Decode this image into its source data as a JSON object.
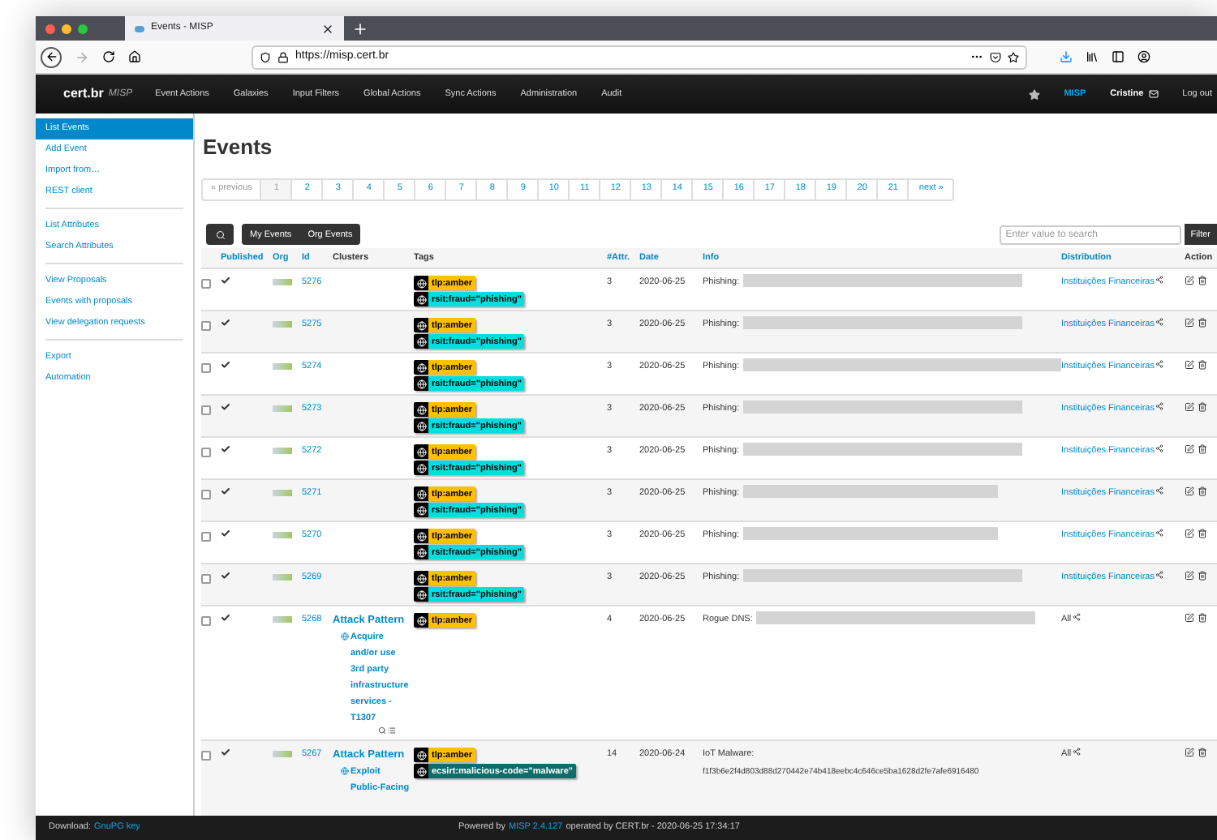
{
  "browser": {
    "tab_title": "Events - MISP",
    "url": "https://misp.cert.br"
  },
  "navbar": {
    "brand": "cert.br",
    "brand_sub": "MISP",
    "items": [
      "Event Actions",
      "Galaxies",
      "Input Filters",
      "Global Actions",
      "Sync Actions",
      "Administration",
      "Audit"
    ],
    "org": "MISP",
    "user": "Cristine",
    "logout": "Log out"
  },
  "sidebar": {
    "groups": [
      [
        {
          "label": "List Events",
          "selected": true
        },
        {
          "label": "Add Event",
          "selected": false
        },
        {
          "label": "Import from…",
          "selected": false
        },
        {
          "label": "REST client",
          "selected": false
        }
      ],
      [
        {
          "label": "List Attributes",
          "selected": false
        },
        {
          "label": "Search Attributes",
          "selected": false
        }
      ],
      [
        {
          "label": "View Proposals",
          "selected": false
        },
        {
          "label": "Events with proposals",
          "selected": false
        },
        {
          "label": "View delegation requests",
          "selected": false
        }
      ],
      [
        {
          "label": "Export",
          "selected": false
        },
        {
          "label": "Automation",
          "selected": false
        }
      ]
    ]
  },
  "page_title": "Events",
  "pagination": {
    "previous": "« previous",
    "next": "next »",
    "pages": [
      {
        "label": "1",
        "selected": true
      },
      {
        "label": "2",
        "selected": false
      },
      {
        "label": "3",
        "selected": false
      },
      {
        "label": "4",
        "selected": false
      },
      {
        "label": "5",
        "selected": false
      },
      {
        "label": "6",
        "selected": false
      },
      {
        "label": "7",
        "selected": false
      },
      {
        "label": "8",
        "selected": false
      },
      {
        "label": "9",
        "selected": false
      },
      {
        "label": "10",
        "selected": false
      },
      {
        "label": "11",
        "selected": false
      },
      {
        "label": "12",
        "selected": false
      },
      {
        "label": "13",
        "selected": false
      },
      {
        "label": "14",
        "selected": false
      },
      {
        "label": "15",
        "selected": false
      },
      {
        "label": "16",
        "selected": false
      },
      {
        "label": "17",
        "selected": false
      },
      {
        "label": "18",
        "selected": false
      },
      {
        "label": "19",
        "selected": false
      },
      {
        "label": "20",
        "selected": false
      },
      {
        "label": "21",
        "selected": false
      }
    ]
  },
  "toolbar": {
    "buttons": [
      "My Events",
      "Org Events"
    ],
    "search_placeholder": "Enter value to search",
    "filter": "Filter"
  },
  "table": {
    "columns": [
      {
        "label": "Published",
        "sortable": true
      },
      {
        "label": "Org",
        "sortable": true
      },
      {
        "label": "Id",
        "sortable": true
      },
      {
        "label": "Clusters",
        "sortable": false
      },
      {
        "label": "Tags",
        "sortable": false
      },
      {
        "label": "#Attr.",
        "sortable": true
      },
      {
        "label": "Date",
        "sortable": true
      },
      {
        "label": "Info",
        "sortable": true
      },
      {
        "label": "Distribution",
        "sortable": true
      },
      {
        "label": "Action",
        "sortable": false
      }
    ],
    "rows": [
      {
        "checked": false,
        "published": true,
        "id": "5276",
        "clusters": [],
        "tags": [
          {
            "label": "tlp:amber",
            "color": "#ffc000"
          },
          {
            "label": "rsit:fraud=\"phishing\"",
            "color": "#00dede"
          }
        ],
        "attributes": "3",
        "date": "2020-06-25",
        "info": "Phishing:",
        "redacted": true,
        "distribution": {
          "label": "Instituições Financeiras",
          "kind": "link"
        }
      },
      {
        "checked": false,
        "published": true,
        "id": "5275",
        "clusters": [],
        "tags": [
          {
            "label": "tlp:amber",
            "color": "#ffc000"
          },
          {
            "label": "rsit:fraud=\"phishing\"",
            "color": "#00dede"
          }
        ],
        "attributes": "3",
        "date": "2020-06-25",
        "info": "Phishing:",
        "redacted": true,
        "distribution": {
          "label": "Instituições Financeiras",
          "kind": "link"
        }
      },
      {
        "checked": false,
        "published": true,
        "id": "5274",
        "clusters": [],
        "tags": [
          {
            "label": "tlp:amber",
            "color": "#ffc000"
          },
          {
            "label": "rsit:fraud=\"phishing\"",
            "color": "#00dede"
          }
        ],
        "attributes": "3",
        "date": "2020-06-25",
        "info": "Phishing:",
        "redacted": true,
        "distribution": {
          "label": "Instituições Financeiras",
          "kind": "link"
        }
      },
      {
        "checked": false,
        "published": true,
        "id": "5273",
        "clusters": [],
        "tags": [
          {
            "label": "tlp:amber",
            "color": "#ffc000"
          },
          {
            "label": "rsit:fraud=\"phishing\"",
            "color": "#00dede"
          }
        ],
        "attributes": "3",
        "date": "2020-06-25",
        "info": "Phishing:",
        "redacted": true,
        "distribution": {
          "label": "Instituições Financeiras",
          "kind": "link"
        }
      },
      {
        "checked": false,
        "published": true,
        "id": "5272",
        "clusters": [],
        "tags": [
          {
            "label": "tlp:amber",
            "color": "#ffc000"
          },
          {
            "label": "rsit:fraud=\"phishing\"",
            "color": "#00dede"
          }
        ],
        "attributes": "3",
        "date": "2020-06-25",
        "info": "Phishing:",
        "redacted": true,
        "distribution": {
          "label": "Instituições Financeiras",
          "kind": "link"
        }
      },
      {
        "checked": false,
        "published": true,
        "id": "5271",
        "clusters": [],
        "tags": [
          {
            "label": "tlp:amber",
            "color": "#ffc000"
          },
          {
            "label": "rsit:fraud=\"phishing\"",
            "color": "#00dede"
          }
        ],
        "attributes": "3",
        "date": "2020-06-25",
        "info": "Phishing:",
        "redacted": true,
        "distribution": {
          "label": "Instituições Financeiras",
          "kind": "link"
        }
      },
      {
        "checked": false,
        "published": true,
        "id": "5270",
        "clusters": [],
        "tags": [
          {
            "label": "tlp:amber",
            "color": "#ffc000"
          },
          {
            "label": "rsit:fraud=\"phishing\"",
            "color": "#00dede"
          }
        ],
        "attributes": "3",
        "date": "2020-06-25",
        "info": "Phishing:",
        "redacted": true,
        "distribution": {
          "label": "Instituições Financeiras",
          "kind": "link"
        }
      },
      {
        "checked": false,
        "published": true,
        "id": "5269",
        "clusters": [],
        "tags": [
          {
            "label": "tlp:amber",
            "color": "#ffc000"
          },
          {
            "label": "rsit:fraud=\"phishing\"",
            "color": "#00dede"
          }
        ],
        "attributes": "3",
        "date": "2020-06-25",
        "info": "Phishing:",
        "redacted": true,
        "distribution": {
          "label": "Instituições Financeiras",
          "kind": "link"
        }
      },
      {
        "checked": false,
        "published": true,
        "id": "5268",
        "clusters": [
          {
            "name": "Attack Pattern",
            "item": "Acquire and/or use 3rd party infrastructure services - T1307",
            "tools": true
          }
        ],
        "tags": [
          {
            "label": "tlp:amber",
            "color": "#ffc000"
          }
        ],
        "attributes": "4",
        "date": "2020-06-25",
        "info": "Rogue DNS:",
        "redacted": true,
        "distribution": {
          "label": "All",
          "kind": "plain"
        }
      },
      {
        "checked": false,
        "published": true,
        "id": "5267",
        "clusters": [
          {
            "name": "Attack Pattern",
            "item": "Exploit Public-Facing",
            "tools": false
          }
        ],
        "tags": [
          {
            "label": "tlp:amber",
            "color": "#ffc000"
          },
          {
            "label": "ecsirt:malicious-code=\"malware\"",
            "color": "#0e6d6a"
          }
        ],
        "attributes": "14",
        "date": "2020-06-24",
        "info": "IoT Malware:",
        "detail": "f1f3b6e2f4d803d88d270442e74b418eebc4c646ce5ba1628d2fe7afe6916480",
        "redacted": false,
        "distribution": {
          "label": "All",
          "kind": "plain"
        }
      }
    ]
  },
  "footer": {
    "download": "Download:",
    "download_link": "GnuPG key",
    "powered": "Powered by",
    "version": "MISP 2.4.127",
    "operated": "operated by CERT.br - 2020-06-25 17:34:17"
  }
}
